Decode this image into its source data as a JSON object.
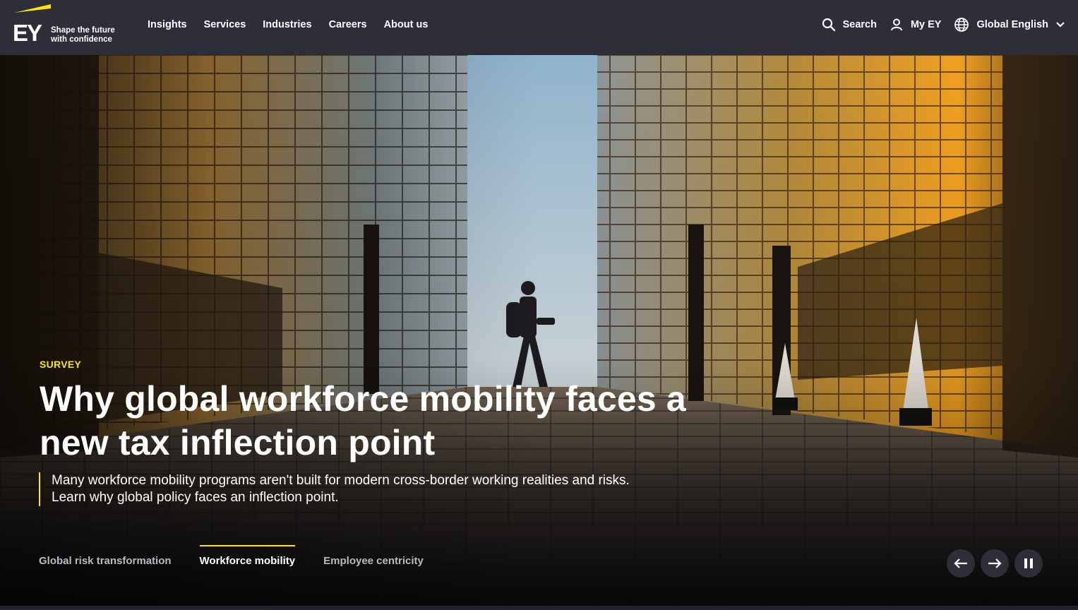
{
  "brand": {
    "logo_text": "EY",
    "tagline_line1": "Shape the future",
    "tagline_line2": "with confidence",
    "accent_color": "#ffe600",
    "header_bg": "#2e2e38"
  },
  "nav": {
    "items": [
      {
        "label": "Insights"
      },
      {
        "label": "Services"
      },
      {
        "label": "Industries"
      },
      {
        "label": "Careers"
      },
      {
        "label": "About us"
      }
    ]
  },
  "utility": {
    "search_label": "Search",
    "account_label": "My EY",
    "language_label": "Global English",
    "icons": [
      "search-icon",
      "user-icon",
      "globe-icon",
      "chevron-down-icon"
    ]
  },
  "hero": {
    "eyebrow": "SURVEY",
    "headline_line1": "Why global workforce mobility faces a",
    "headline_line2": "new tax inflection point",
    "summary_line1": "Many workforce mobility programs aren't built for modern cross-border working realities and risks.",
    "summary_line2": "Learn why global policy faces an inflection point.",
    "tabs": [
      {
        "label": "Global risk transformation",
        "active": false
      },
      {
        "label": "Workforce mobility",
        "active": true
      },
      {
        "label": "Employee centricity",
        "active": false
      }
    ],
    "controls": [
      "arrow-left-icon",
      "arrow-right-icon",
      "pause-icon"
    ]
  }
}
